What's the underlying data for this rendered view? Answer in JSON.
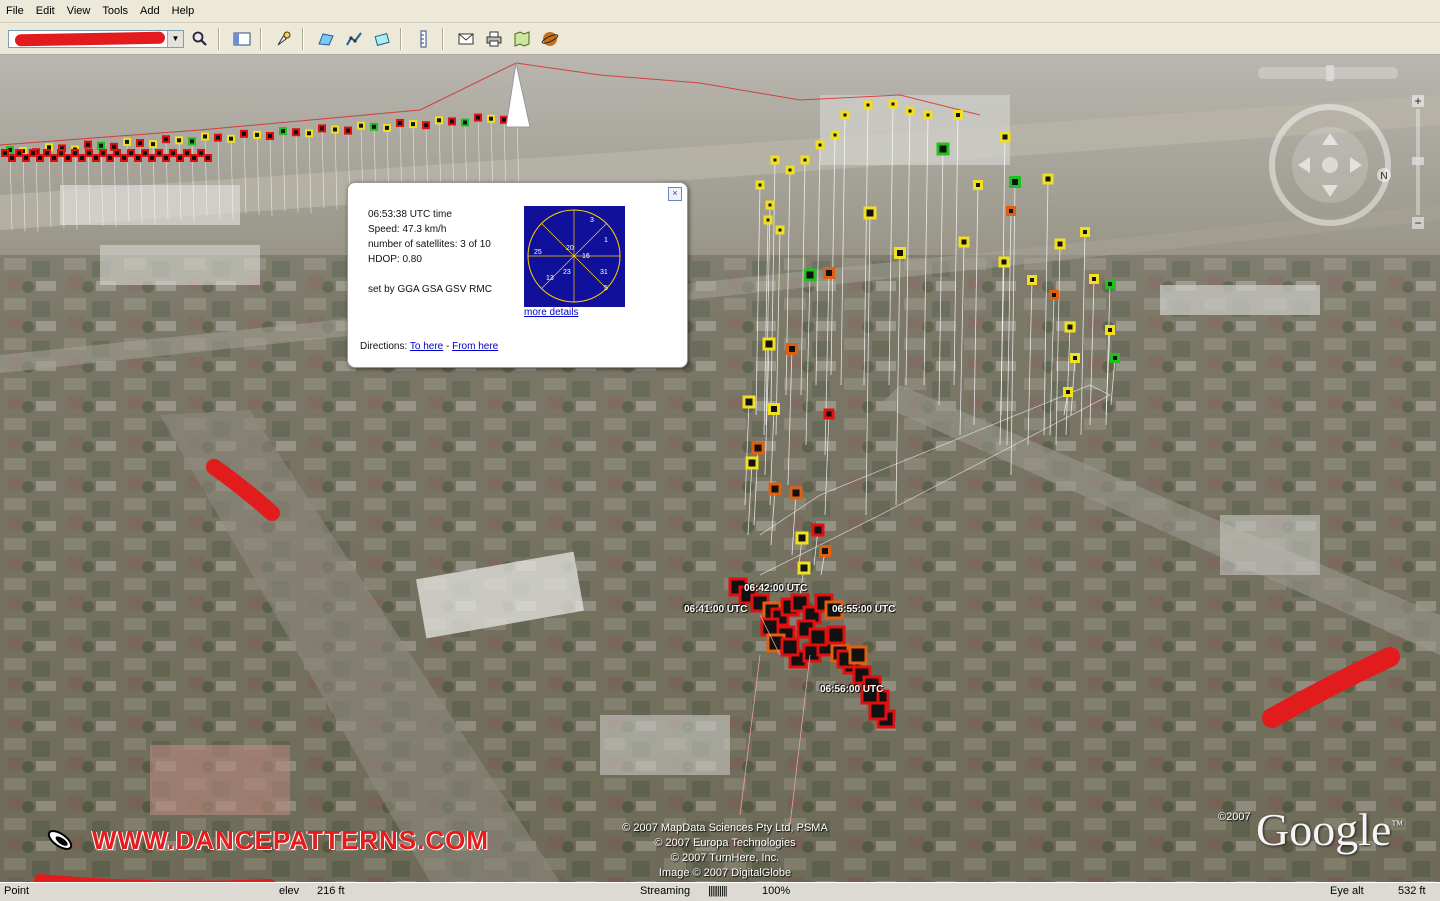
{
  "menu": [
    "File",
    "Edit",
    "View",
    "Tools",
    "Add",
    "Help"
  ],
  "toolbar": {
    "buttons": [
      "search-icon",
      "sidebar-icon",
      "placemark-icon",
      "polygon-icon",
      "path-icon",
      "image-overlay-icon",
      "ruler-icon",
      "email-icon",
      "print-icon",
      "map-icon",
      "sky-icon"
    ]
  },
  "popup": {
    "time": "06:53:38 UTC time",
    "speed": "Speed: 47.3 km/h",
    "satellites": "number of satellites: 3 of 10",
    "hdop": "HDOP: 0.80",
    "sentences": "set by GGA GSA GSV RMC",
    "more_details": "more details",
    "directions_label": "Directions:",
    "to_here": "To here",
    "separator": " - ",
    "from_here": "From here",
    "skyplot_sats": [
      "3",
      "1",
      "20",
      "16",
      "25",
      "23",
      "13",
      "31",
      "5"
    ]
  },
  "timestamps": [
    "06:42:00 UTC",
    "06:41:00 UTC",
    "06:55:00 UTC",
    "06:56:00 UTC"
  ],
  "copyright": [
    "© 2007 MapData Sciences Pty Ltd, PSMA",
    "© 2007 Europa Technologies",
    "© 2007 TurnHere, Inc.",
    "Image © 2007 DigitalGlobe"
  ],
  "logo": {
    "text": "Google",
    "tm": "™",
    "year": "©2007"
  },
  "watermark": "WWW.DANCEPATTERNS.COM",
  "status": {
    "pointer_label": "Point",
    "elev_label": "elev",
    "elev_value": "216 ft",
    "streaming_label": "Streaming",
    "streaming_bars": "||||||||||",
    "streaming_pct": "100%",
    "eye_label": "Eye alt",
    "eye_value": "532 ft"
  },
  "colors": {
    "red": "#e01010",
    "orange": "#e06010",
    "yellow": "#f0e020",
    "green": "#20c020",
    "accent": "#10109a"
  }
}
